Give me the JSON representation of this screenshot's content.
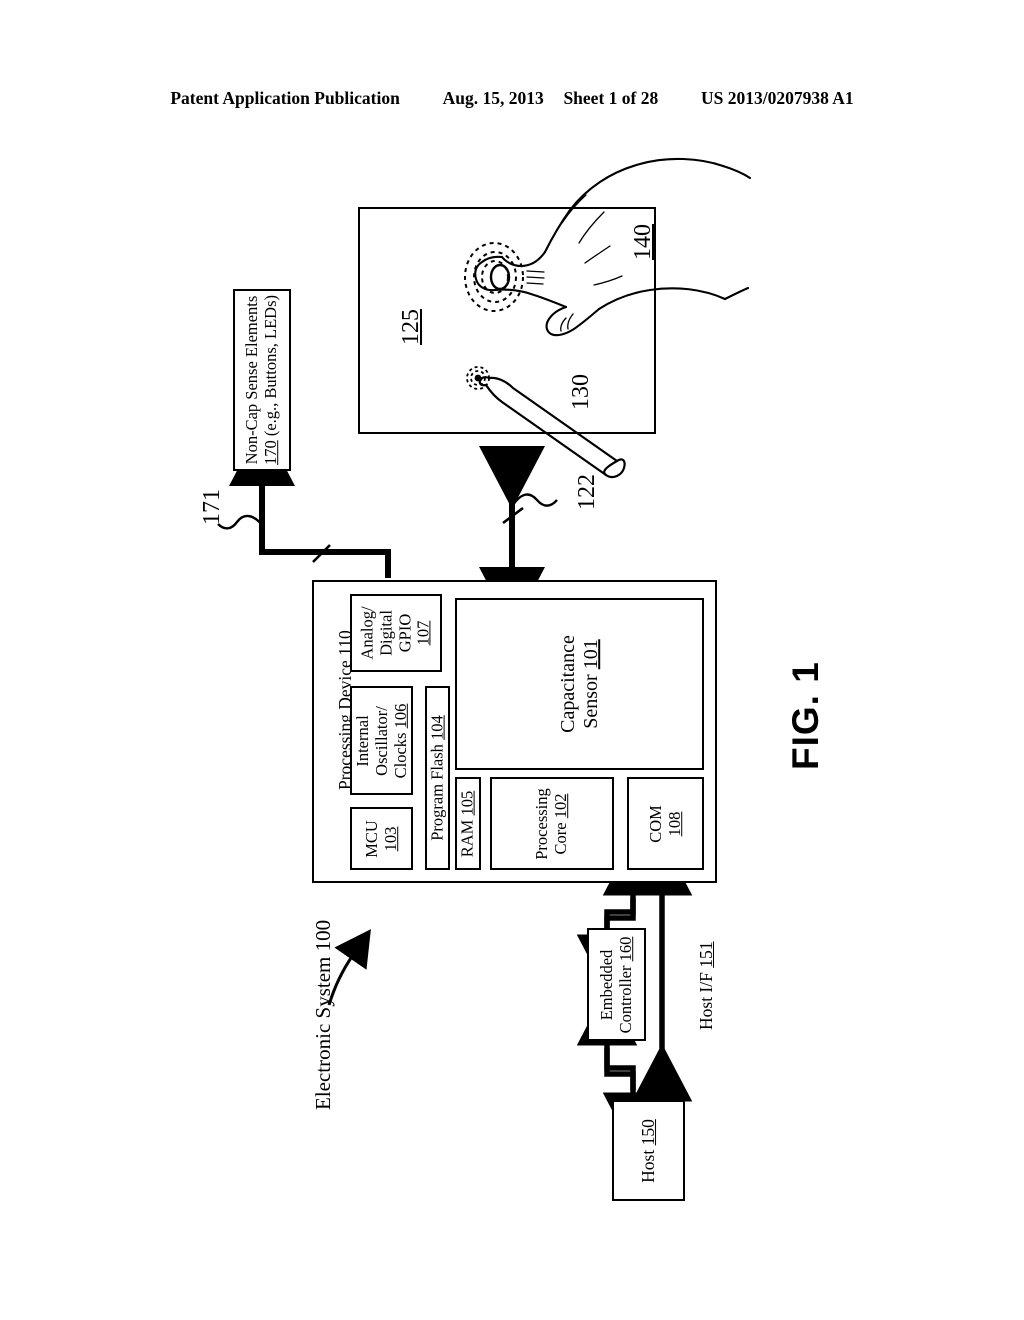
{
  "header": {
    "publication": "Patent Application Publication",
    "date": "Aug. 15, 2013",
    "sheet": "Sheet 1 of 28",
    "patent_number": "US 2013/0207938 A1"
  },
  "figure": {
    "figure_label": "FIG. 1",
    "system_label": "Electronic System 100",
    "blocks": {
      "non_cap_sense": {
        "line1": "Non-Cap Sense Elements",
        "line2": "170 (e.g., Buttons, LEDs)",
        "ref": "170"
      },
      "touchscreen": {
        "ref": "125"
      },
      "stylus": {
        "ref": "130"
      },
      "hand": {
        "ref": "140"
      },
      "processing_device": {
        "label": "Processing Device 110",
        "ref": "110"
      },
      "analog_digital_gpio": {
        "line1": "Analog/",
        "line2": "Digital",
        "line3": "GPIO",
        "line4": "107",
        "ref": "107"
      },
      "internal_oscillator": {
        "line1": "Internal",
        "line2": "Oscillator/",
        "line3": "Clocks 106",
        "ref": "106"
      },
      "mcu": {
        "line1": "MCU",
        "line2": "103",
        "ref": "103"
      },
      "program_flash": {
        "label": "Program Flash 104",
        "ref": "104"
      },
      "ram": {
        "label": "RAM 105",
        "ref": "105"
      },
      "capacitance_sensor": {
        "line1": "Capacitance",
        "line2": "Sensor 101",
        "ref": "101"
      },
      "processing_core": {
        "line1": "Processing",
        "line2": "Core 102",
        "ref": "102"
      },
      "com": {
        "line1": "COM",
        "line2": "108",
        "ref": "108"
      },
      "embedded_controller": {
        "line1": "Embedded",
        "line2": "Controller 160",
        "ref": "160"
      },
      "host": {
        "label": "Host 150",
        "ref": "150"
      },
      "host_if": {
        "label": "Host I/F 151",
        "ref": "151"
      }
    },
    "connector_refs": {
      "non_cap_bus": "171",
      "touchscreen_bus": "122"
    }
  }
}
